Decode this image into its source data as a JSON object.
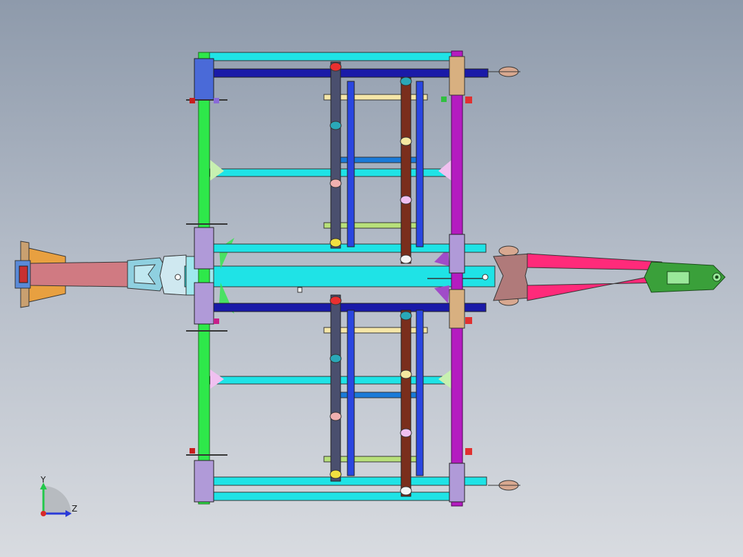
{
  "viewport": {
    "background": [
      "#8e9aab",
      "#d8dbe0"
    ]
  },
  "triad": {
    "y_label": "Y",
    "z_label": "Z",
    "y_color": "#22c84a",
    "z_color": "#2a3ad8",
    "origin_color": "#d82a2a"
  },
  "palette": {
    "cross_beam": "#1fe3e6",
    "top_rail": "#1a1aa8",
    "left_beam": "#2ee84a",
    "right_beam": "#b41cc0",
    "shaft_dark": "#4a4f6e",
    "shaft_brown": "#7a2e1c",
    "shaft_blue": "#2a46e0",
    "drawbar": "#ff2a7a",
    "hitch": "#3aa03a",
    "axle_tube": "#d07a82",
    "flange": "#e8a040"
  }
}
